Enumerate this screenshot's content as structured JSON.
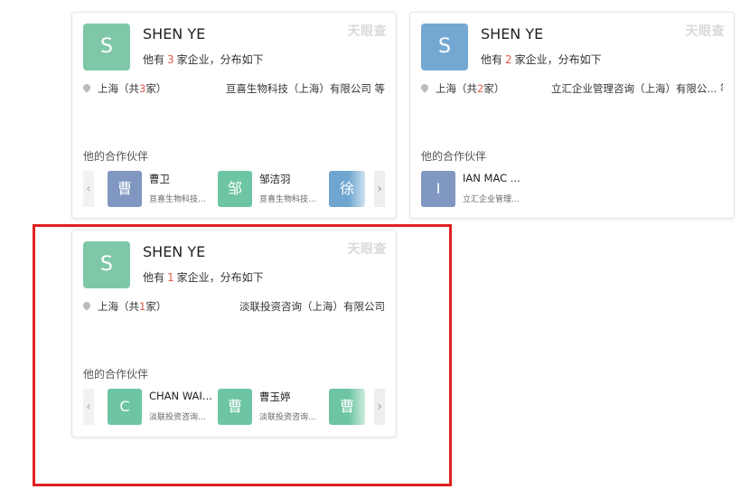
{
  "watermark": "天眼查",
  "partner_title": "他的合作伙伴",
  "cards": [
    {
      "avatar_letter": "S",
      "avatar_color": "#7ec8a8",
      "name": "SHEN YE",
      "summary_prefix": "他有",
      "count": "3",
      "summary_suffix": "家企业，分布如下",
      "location": "上海",
      "loc_prefix": "（共",
      "loc_count": "3",
      "loc_suffix": "家）",
      "company": "亘喜生物科技（上海）有限公司 等",
      "partners": [
        {
          "letter": "曹",
          "color": "#7f97c1",
          "name": "曹卫",
          "company": "亘喜生物科技..."
        },
        {
          "letter": "邹",
          "color": "#6dc5a3",
          "name": "邹洁羽",
          "company": "亘喜生物科技..."
        }
      ],
      "peek": {
        "letter": "徐",
        "color": "#6fa6d0"
      }
    },
    {
      "avatar_letter": "S",
      "avatar_color": "#74a8d2",
      "name": "SHEN YE",
      "summary_prefix": "他有",
      "count": "2",
      "summary_suffix": "家企业，分布如下",
      "location": "上海",
      "loc_prefix": "（共",
      "loc_count": "2",
      "loc_suffix": "家）",
      "company": "立汇企业管理咨询（上海）有限公... 等",
      "partners": [
        {
          "letter": "I",
          "color": "#7f97c1",
          "name": "IAN MAC ...",
          "company": "立汇企业管理..."
        }
      ]
    },
    {
      "avatar_letter": "S",
      "avatar_color": "#7ec8a8",
      "name": "SHEN YE",
      "summary_prefix": "他有",
      "count": "1",
      "summary_suffix": "家企业，分布如下",
      "location": "上海",
      "loc_prefix": "（共",
      "loc_count": "1",
      "loc_suffix": "家）",
      "company": "淡联投资咨询（上海）有限公司",
      "partners": [
        {
          "letter": "C",
          "color": "#6dc5a3",
          "name": "CHAN WAI...",
          "company": "淡联投资咨询..."
        },
        {
          "letter": "曹",
          "color": "#6dc5a3",
          "name": "曹玉婷",
          "company": "淡联投资咨询..."
        }
      ],
      "peek": {
        "letter": "曹",
        "color": "#6dc5a3"
      }
    }
  ],
  "arrows": {
    "left": "‹",
    "right": "›"
  }
}
